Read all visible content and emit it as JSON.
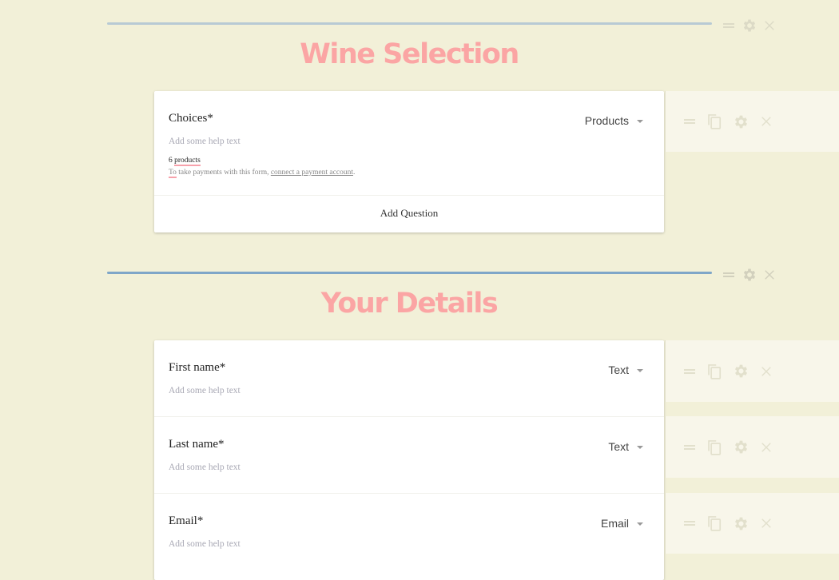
{
  "colors": {
    "background": "#f2f0d8",
    "title": "#fba5a4",
    "divider_first": "#b8cad4",
    "divider_second": "#7fa6c8",
    "underline_accent": "#f7a1ab"
  },
  "sections": [
    {
      "title": "Wine Selection",
      "tools": [
        "drag-handle-icon",
        "gear-icon",
        "close-icon"
      ],
      "questions": [
        {
          "label": "Choices*",
          "help_placeholder": "Add some help text",
          "type": "Products",
          "products_count": "6",
          "products_word": "products",
          "payment_prefix_first": "To",
          "payment_prefix_rest": " take payments with this form, ",
          "payment_link": "connect a payment account",
          "payment_suffix": ".",
          "tools": [
            "drag-handle-icon",
            "copy-icon",
            "gear-icon",
            "close-icon"
          ]
        }
      ],
      "add_question_label": "Add Question"
    },
    {
      "title": "Your Details",
      "tools": [
        "drag-handle-icon",
        "gear-icon",
        "close-icon"
      ],
      "questions": [
        {
          "label": "First name*",
          "help_placeholder": "Add some help text",
          "type": "Text",
          "tools": [
            "drag-handle-icon",
            "copy-icon",
            "gear-icon",
            "close-icon"
          ]
        },
        {
          "label": "Last name*",
          "help_placeholder": "Add some help text",
          "type": "Text",
          "tools": [
            "drag-handle-icon",
            "copy-icon",
            "gear-icon",
            "close-icon"
          ]
        },
        {
          "label": "Email*",
          "help_placeholder": "Add some help text",
          "type": "Email",
          "tools": [
            "drag-handle-icon",
            "copy-icon",
            "gear-icon",
            "close-icon"
          ]
        }
      ]
    }
  ]
}
